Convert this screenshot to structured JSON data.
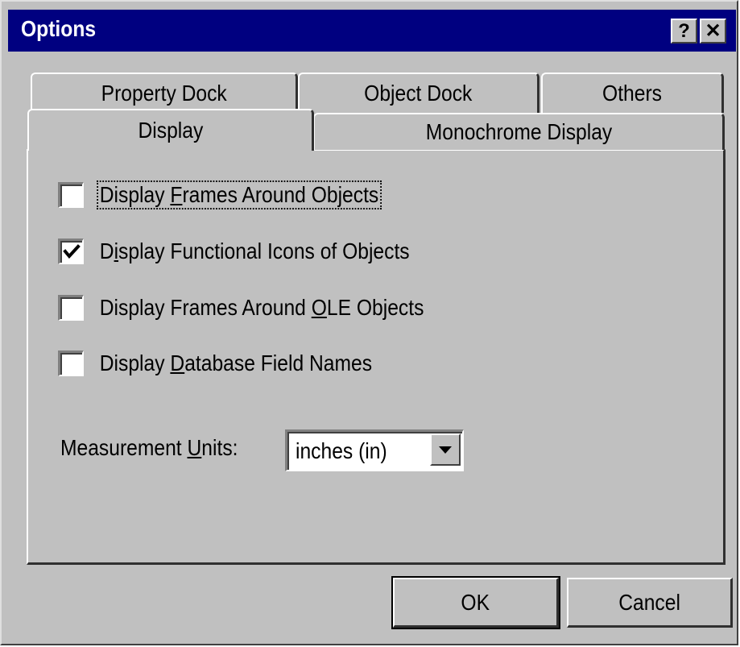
{
  "window": {
    "title": "Options",
    "help_glyph": "?",
    "close_glyph": "✕"
  },
  "tabs": {
    "back_row": [
      {
        "label": "Property Dock"
      },
      {
        "label": "Object Dock"
      },
      {
        "label": "Others"
      }
    ],
    "front_row": [
      {
        "label": "Display",
        "selected": true
      },
      {
        "label": "Monochrome Display",
        "selected": false
      }
    ]
  },
  "display": {
    "checkboxes": [
      {
        "pre": "Display ",
        "mnemonic": "F",
        "post": "rames Around Objects",
        "checked": false,
        "focused": true
      },
      {
        "pre": "D",
        "mnemonic": "i",
        "post": "splay Functional Icons of Objects",
        "checked": true,
        "focused": false
      },
      {
        "pre": "Display Frames Around ",
        "mnemonic": "O",
        "post": "LE Objects",
        "checked": false,
        "focused": false
      },
      {
        "pre": "Display ",
        "mnemonic": "D",
        "post": "atabase Field Names",
        "checked": false,
        "focused": false
      }
    ],
    "measurement": {
      "label_pre": "Measurement ",
      "label_mnemonic": "U",
      "label_post": "nits:",
      "value": "inches (in)"
    }
  },
  "buttons": {
    "ok": "OK",
    "cancel": "Cancel"
  },
  "icons": {
    "help": "help-icon",
    "close": "close-icon",
    "check": "checkmark-icon",
    "dropdown": "chevron-down-icon"
  },
  "colors": {
    "face": "#c0c0c0",
    "titlebar": "#000080",
    "title_text": "#ffffff"
  }
}
